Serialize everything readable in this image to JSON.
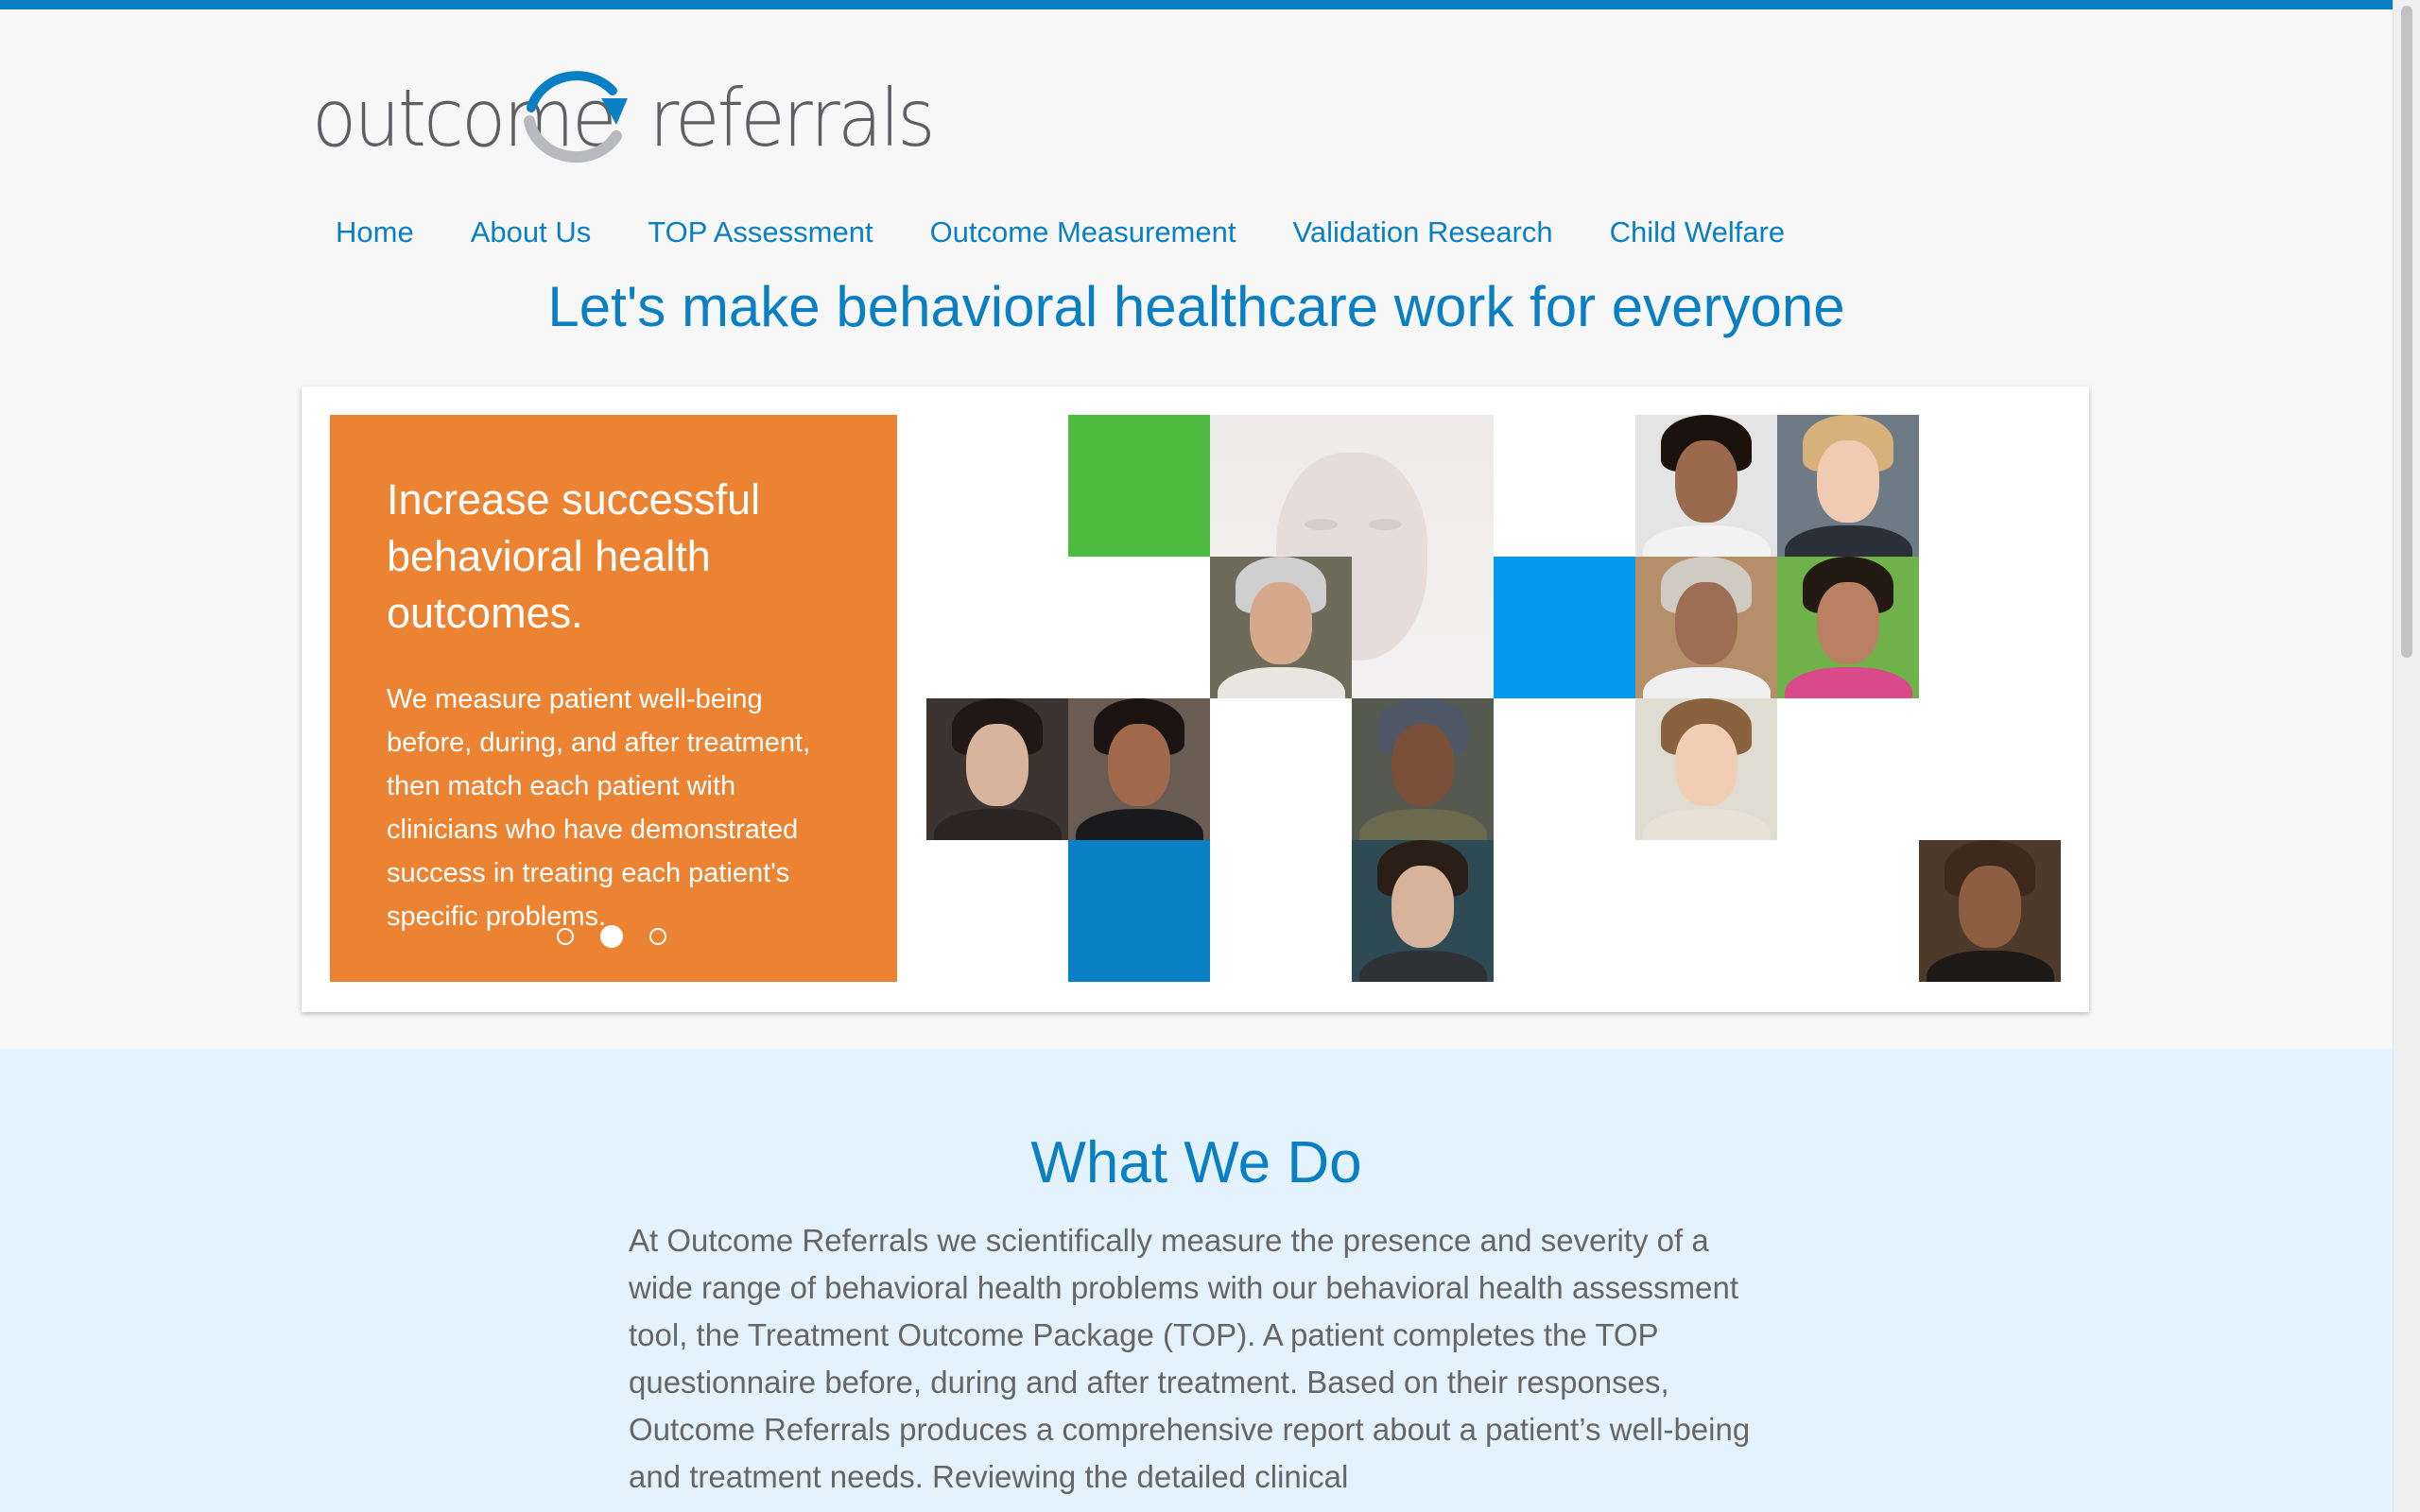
{
  "logo": {
    "word1": "outcome",
    "word2": "referrals"
  },
  "nav": {
    "items": [
      {
        "label": "Home"
      },
      {
        "label": "About Us"
      },
      {
        "label": "TOP Assessment"
      },
      {
        "label": "Outcome Measurement"
      },
      {
        "label": "Validation Research"
      },
      {
        "label": "Child Welfare"
      }
    ]
  },
  "tagline": "Let's make behavioral healthcare work for everyone",
  "hero": {
    "heading": "Increase successful behavioral health outcomes.",
    "body": "We measure patient well-being before, during, and after treatment, then match each patient with clinicians who have demonstrated success in treating each patient's specific problems.",
    "carousel": {
      "slides": 3,
      "active_index": 1
    }
  },
  "what_we_do": {
    "title": "What We Do",
    "body": "At Outcome Referrals we scientifically measure the presence and severity of a wide range of behavioral health problems with our behavioral health assessment tool, the Treatment Outcome Package (TOP). A patient completes the TOP questionnaire before, during and after treatment. Based on their responses, Outcome Referrals produces a comprehensive report about a patient’s well-being and treatment needs. Reviewing the detailed clinical"
  },
  "colors": {
    "brand_blue": "#0a7fc4",
    "promo_orange": "#ec8332",
    "tile_green": "#4cbb3f",
    "tile_light_blue": "#0699f0",
    "tile_dark_blue": "#0a80c7",
    "section_bg": "#e3f2fc"
  }
}
